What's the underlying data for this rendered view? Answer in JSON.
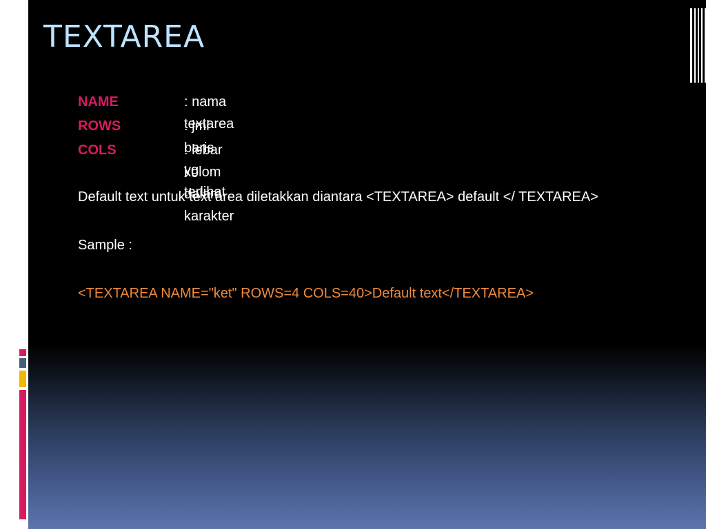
{
  "slide": {
    "title": "TEXTAREA",
    "attributes": [
      {
        "key": "NAME",
        "desc": ": nama textarea"
      },
      {
        "key": "ROWS",
        "desc": ": jml baris yg terlihat"
      },
      {
        "key": "COLS",
        "desc": ": lebar kolom dalam karakter"
      }
    ],
    "default_text": "Default text untuk text area diletakkan diantara <TEXTAREA> default </ TEXTAREA>",
    "sample_label": "Sample :",
    "sample_code": "<TEXTAREA NAME=\"ket\" ROWS=4 COLS=40>Default text</TEXTAREA>"
  },
  "colors": {
    "title": "#bfe3ff",
    "attribute_key": "#d81b60",
    "code": "#ef8a3b",
    "accent_pink": "#d81b60",
    "accent_yellow": "#f2b705",
    "accent_slate": "#4a5d78"
  },
  "icons": [
    "vertical-stripes-decoration"
  ]
}
